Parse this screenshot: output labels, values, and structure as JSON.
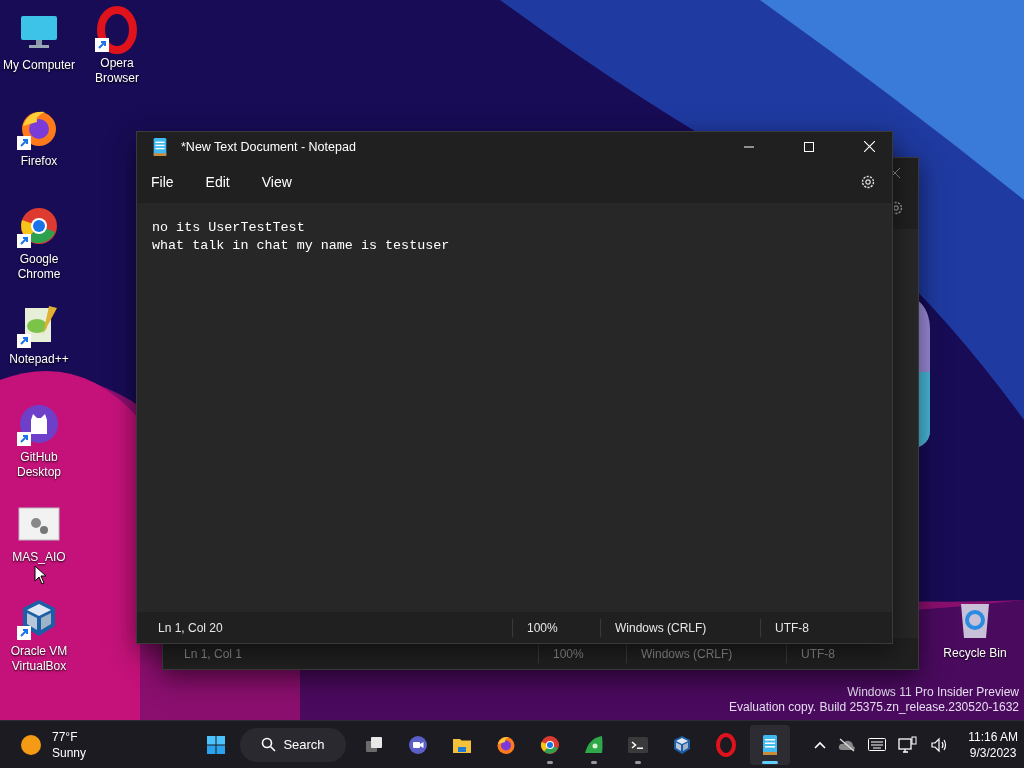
{
  "desktop_icons": [
    {
      "kind": "computer",
      "label": "My Computer",
      "shortcut": false
    },
    {
      "kind": "opera",
      "label": "Opera Browser",
      "shortcut": true
    },
    {
      "kind": "firefox",
      "label": "Firefox",
      "shortcut": true
    },
    {
      "kind": "chrome",
      "label": "Google Chrome",
      "shortcut": true
    },
    {
      "kind": "notepadpp",
      "label": "Notepad++",
      "shortcut": true
    },
    {
      "kind": "github",
      "label": "GitHub Desktop",
      "shortcut": true
    },
    {
      "kind": "gears",
      "label": "MAS_AIO",
      "shortcut": false
    },
    {
      "kind": "vbox",
      "label": "Oracle VM VirtualBox",
      "shortcut": true
    },
    {
      "kind": "recycle",
      "label": "Recycle Bin",
      "shortcut": false
    }
  ],
  "back_window": {
    "status": [
      "Ln 1, Col 1",
      "100%",
      "Windows (CRLF)",
      "UTF-8"
    ]
  },
  "window": {
    "title": "*New Text Document - Notepad",
    "menu": [
      "File",
      "Edit",
      "View"
    ],
    "lines": [
      "no its UserTestTest",
      "what talk in chat my name is testuser"
    ],
    "status": [
      "Ln 1, Col 20",
      "100%",
      "Windows (CRLF)",
      "UTF-8"
    ]
  },
  "edition_note": [
    "Windows 11 Pro Insider Preview",
    "Evaluation copy. Build 25375.zn_release.230520-1632"
  ],
  "taskbar": {
    "weather": {
      "temperature": "77°F",
      "condition": "Sunny"
    },
    "search": "Search",
    "apps": [
      {
        "kind": "start",
        "running": false,
        "selected": false
      },
      {
        "kind": "search"
      },
      {
        "kind": "taskview",
        "running": false,
        "selected": false
      },
      {
        "kind": "meet",
        "running": false,
        "selected": false
      },
      {
        "kind": "explorer",
        "running": false,
        "selected": false
      },
      {
        "kind": "firefox",
        "running": false,
        "selected": false
      },
      {
        "kind": "chrome",
        "running": true,
        "selected": false
      },
      {
        "kind": "leaf",
        "running": true,
        "selected": false
      },
      {
        "kind": "terminal",
        "running": true,
        "selected": false
      },
      {
        "kind": "vbox",
        "running": false,
        "selected": false
      },
      {
        "kind": "opera",
        "running": false,
        "selected": false
      },
      {
        "kind": "notepad",
        "running": true,
        "selected": true
      }
    ],
    "clock": {
      "time": "11:16 AM",
      "date": "9/3/2023"
    }
  }
}
